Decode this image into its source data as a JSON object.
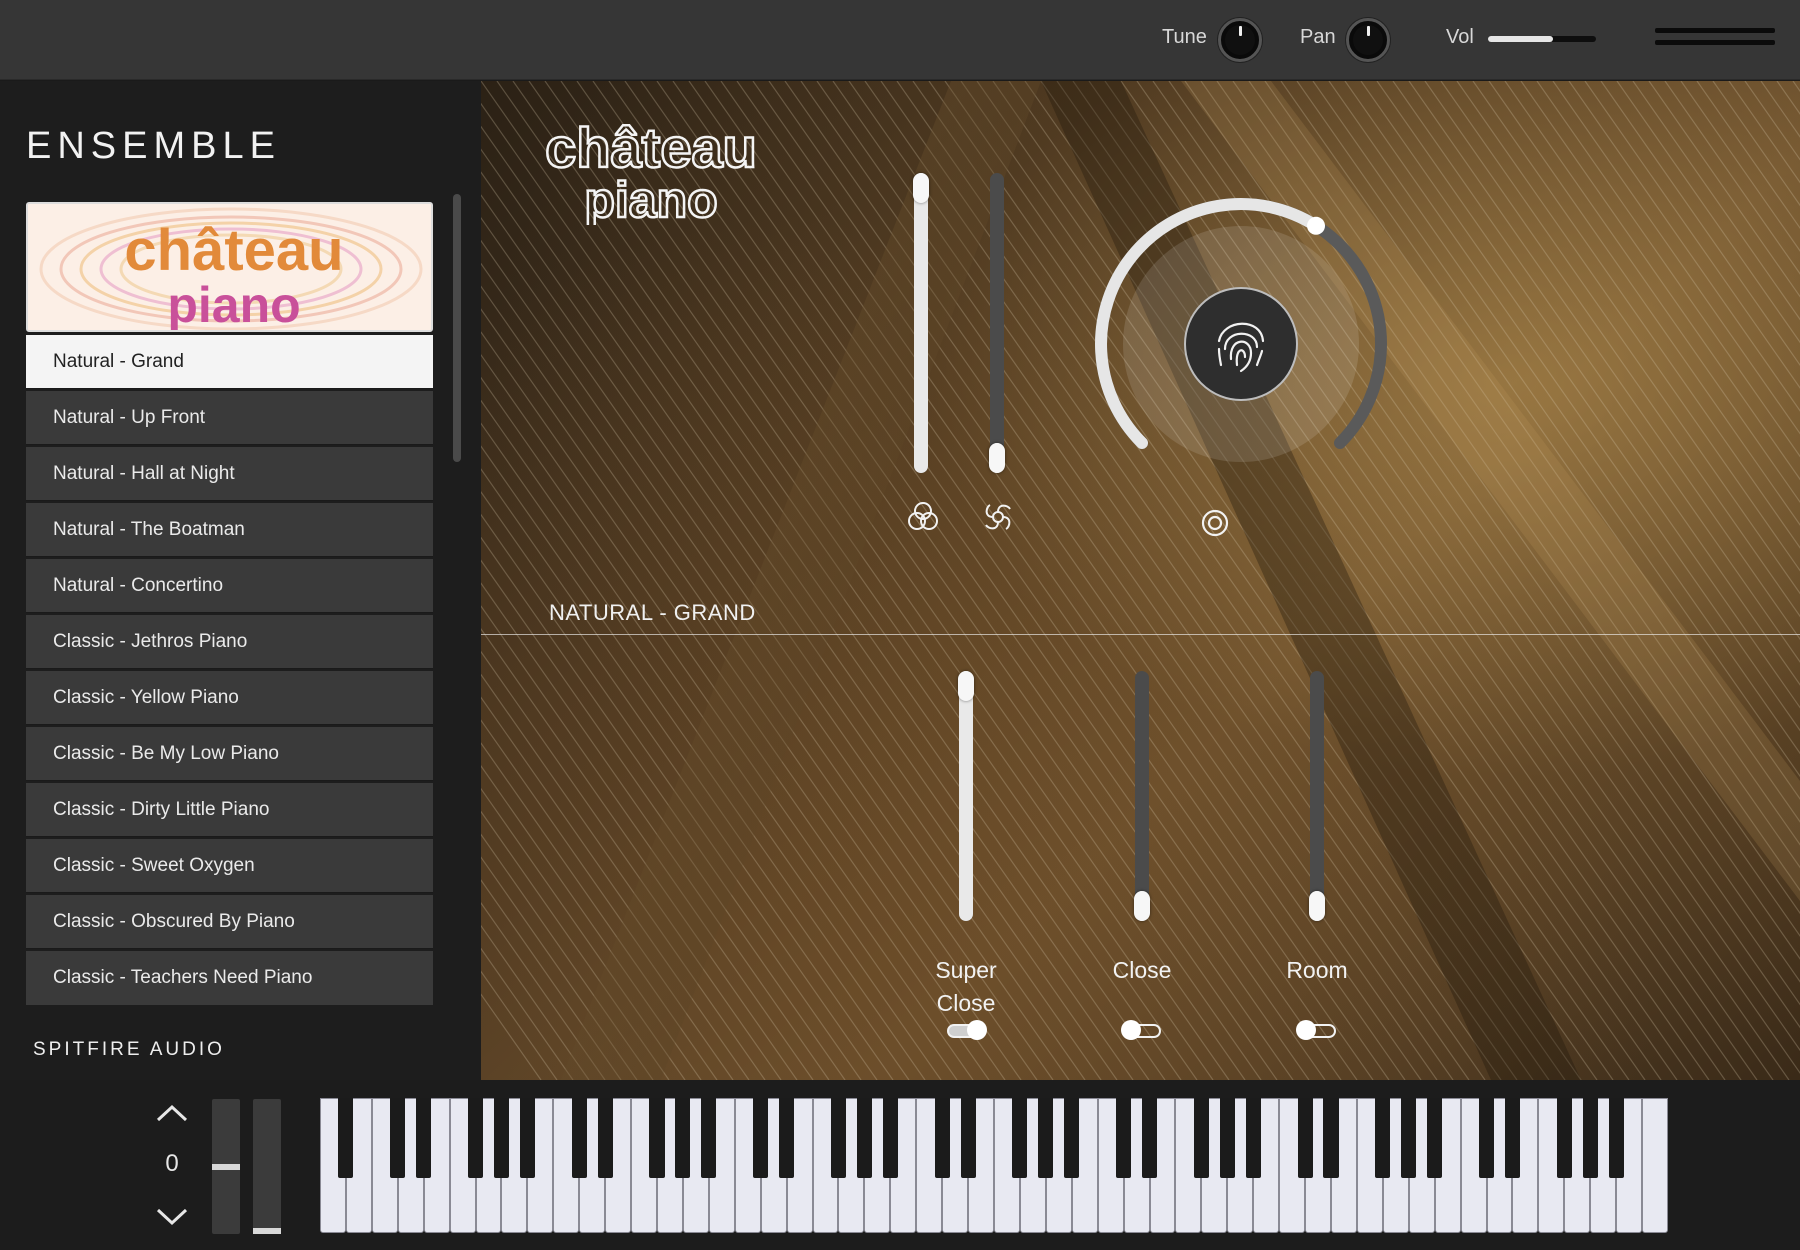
{
  "topbar": {
    "tune_label": "Tune",
    "pan_label": "Pan",
    "vol_label": "Vol",
    "tune_icon": "knob-icon",
    "pan_icon": "knob-icon",
    "vol_level": 0.6,
    "menu_icon": "hamburger-menu-icon"
  },
  "sidebar": {
    "title": "ENSEMBLE",
    "art_logo": {
      "line1": "château",
      "line2": "piano",
      "colors": [
        "#e79a3a",
        "#c9509a",
        "#f3c9b0"
      ]
    },
    "presets": [
      "Natural - Grand",
      "Natural - Up Front",
      "Natural - Hall at Night",
      "Natural - The Boatman",
      "Natural - Concertino",
      "Classic - Jethros Piano",
      "Classic - Yellow Piano",
      "Classic - Be My Low Piano",
      "Classic - Dirty Little Piano",
      "Classic - Sweet Oxygen",
      "Classic - Obscured By Piano",
      "Classic - Teachers Need Piano"
    ],
    "active_index": 0,
    "brand": "SPITFIRE AUDIO"
  },
  "main": {
    "logo": {
      "line1": "château",
      "line2": "piano"
    },
    "section_name": "NATURAL - GRAND",
    "upper_sliders": [
      {
        "icon": "tri-circles-icon",
        "level": 1.0
      },
      {
        "icon": "swirl-icon",
        "level": 0.0
      }
    ],
    "expression_dial": {
      "icon": "fingerprint-icon",
      "level": 0.62,
      "bottom_icon": "ring-target-icon"
    },
    "mics": [
      {
        "label": "Super Close",
        "label_line1": "Super",
        "label_line2": "Close",
        "level": 1.0,
        "on": true
      },
      {
        "label": "Close",
        "label_line1": "Close",
        "label_line2": "",
        "level": 0.0,
        "on": false
      },
      {
        "label": "Room",
        "label_line1": "Room",
        "label_line2": "",
        "level": 0.0,
        "on": false
      }
    ],
    "accent": "#e9e9e9"
  },
  "keyboard": {
    "octave_up_icon": "chevron-up-icon",
    "octave_down_icon": "chevron-down-icon",
    "octave_value": "0",
    "pitch_wheel_level": 0.5,
    "mod_wheel_level": 0.0,
    "white_keys": 52
  }
}
